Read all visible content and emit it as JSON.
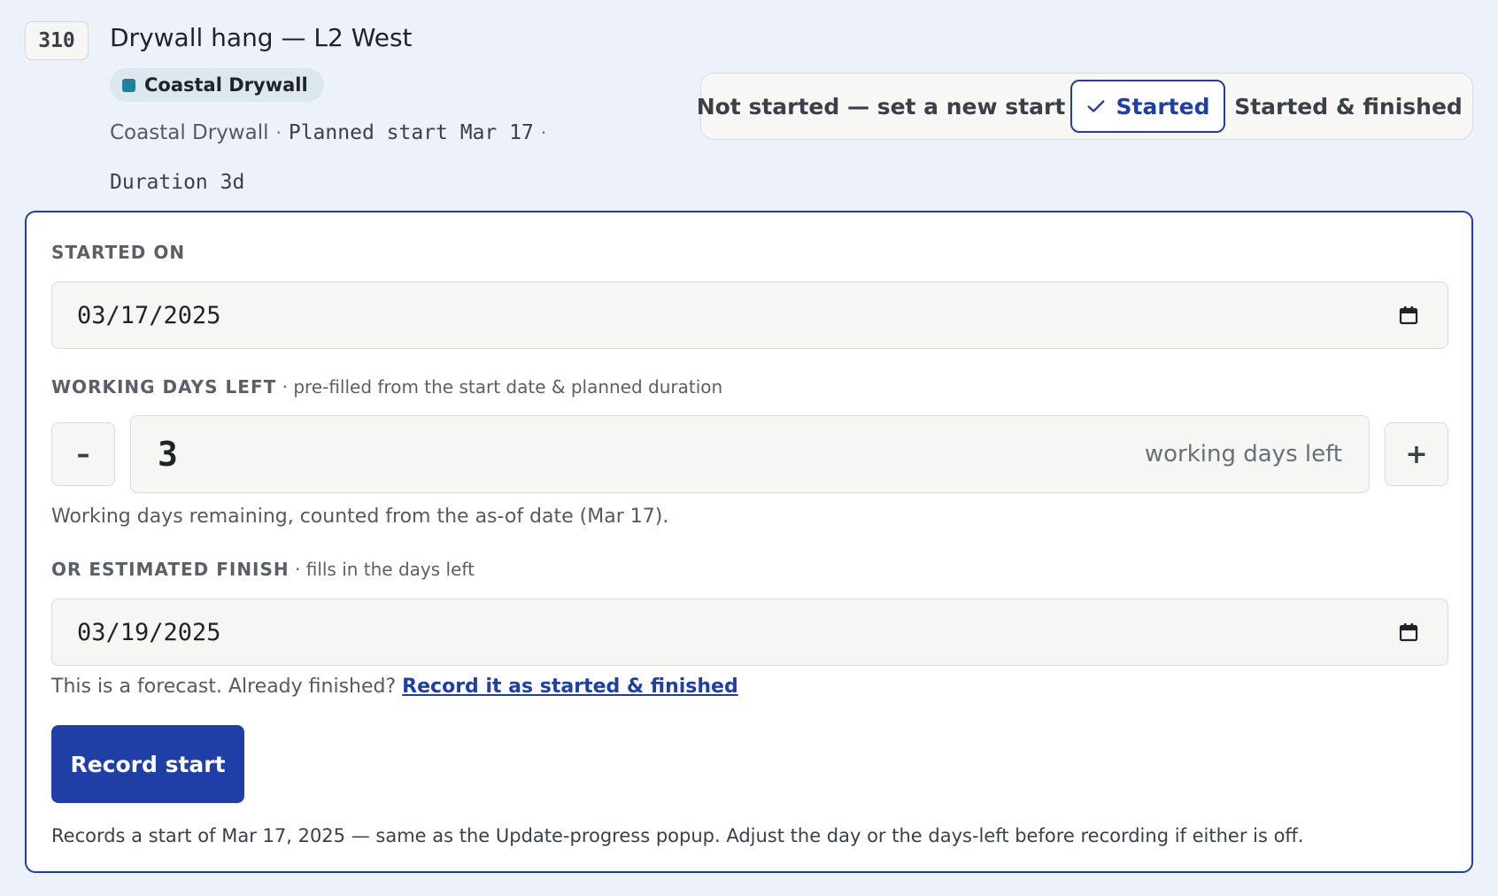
{
  "task": {
    "id": "310",
    "title": "Drywall hang — L2 West",
    "crew_chip": "Coastal Drywall",
    "crew_color": "#1e8396",
    "meta": {
      "crew": "Coastal Drywall",
      "separator": "·",
      "planned_start": "Planned start Mar 17",
      "duration": "Duration 3d"
    }
  },
  "status_toggle": {
    "options": [
      "Not started — set a new start",
      "Started",
      "Started & finished"
    ],
    "selected": "Started",
    "selected_icon": "check-icon"
  },
  "form": {
    "started_on": {
      "label": "STARTED ON",
      "value": "03/17/2025",
      "icon": "calendar-icon"
    },
    "working_days_left": {
      "label": "WORKING DAYS LEFT",
      "hint": "· pre-filled from the start date & planned duration",
      "value": "3",
      "unit": "working days left",
      "decrement": "–",
      "increment": "+",
      "help": "Working days remaining, counted from the as-of date (Mar 17)."
    },
    "estimated_finish": {
      "label": "OR ESTIMATED FINISH",
      "hint": "· fills in the days left",
      "value": "03/19/2025",
      "icon": "calendar-icon"
    },
    "forecast_note": "This is a forecast. Already finished?",
    "forecast_link": "Record it as started & finished",
    "submit_label": "Record start",
    "footnote": "Records a start of Mar 17, 2025 — same as the Update-progress popup. Adjust the day or the days-left before recording if either is off."
  },
  "colors": {
    "accent": "#1f3fa6",
    "background": "#edf2fa"
  }
}
